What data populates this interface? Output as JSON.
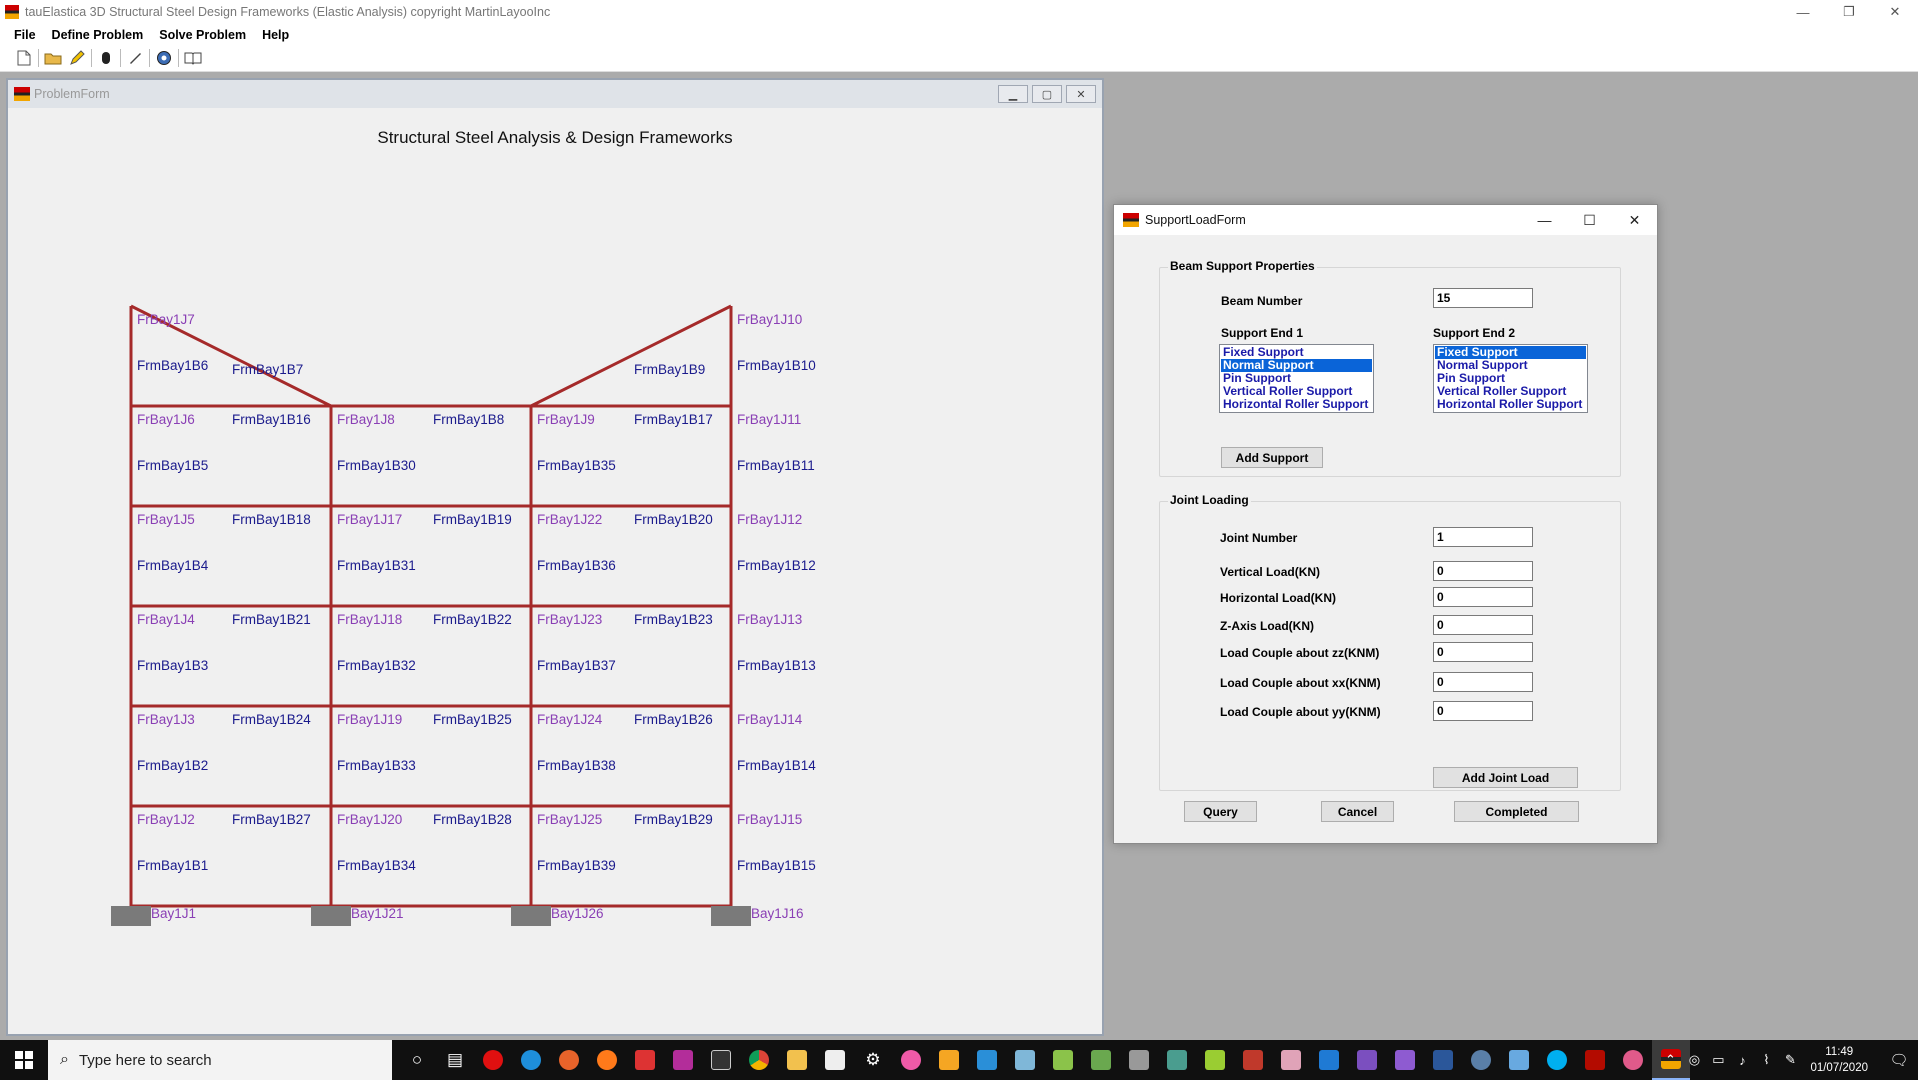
{
  "app": {
    "title": "tauElastica 3D Structural Steel Design Frameworks (Elastic Analysis) copyright MartinLayooInc",
    "menu": [
      "File",
      "Define Problem",
      "Solve Problem",
      "Help"
    ],
    "toolbar_icons": [
      "new-file-icon",
      "open-folder-icon",
      "pencil-icon",
      "mouse-icon",
      "brush-icon",
      "compass-icon",
      "book-icon"
    ]
  },
  "problem_form": {
    "title": "ProblemForm",
    "heading": "Structural Steel Analysis & Design Frameworks",
    "frame_color": "#a52a2a",
    "support_color": "#7a7a7a",
    "joint_label_color": "#8a3fb5",
    "beam_label_color": "#1a1a8c",
    "joint_labels": [
      "FrBay1J7",
      "FrBay1J10",
      "FrBay1J6",
      "FrBay1J8",
      "FrBay1J9",
      "FrBay1J11",
      "FrBay1J5",
      "FrBay1J17",
      "FrBay1J22",
      "FrBay1J12",
      "FrBay1J4",
      "FrBay1J18",
      "FrBay1J23",
      "FrBay1J13",
      "FrBay1J3",
      "FrBay1J19",
      "FrBay1J24",
      "FrBay1J14",
      "FrBay1J2",
      "FrBay1J20",
      "FrBay1J25",
      "FrBay1J15",
      "Bay1J1",
      "Bay1J21",
      "Bay1J26",
      "Bay1J16"
    ],
    "beam_labels": [
      "FrmBay1B6",
      "FrmBay1B7",
      "FrmBay1B9",
      "FrmBay1B10",
      "FrmBay1B16",
      "FrmBay1B8",
      "FrmBay1B17",
      "FrmBay1B5",
      "FrmBay1B30",
      "FrmBay1B35",
      "FrmBay1B11",
      "FrmBay1B18",
      "FrmBay1B19",
      "FrmBay1B20",
      "FrmBay1B4",
      "FrmBay1B31",
      "FrmBay1B36",
      "FrmBay1B12",
      "FrmBay1B21",
      "FrmBay1B22",
      "FrmBay1B23",
      "FrmBay1B3",
      "FrmBay1B32",
      "FrmBay1B37",
      "FrmBay1B13",
      "FrmBay1B24",
      "FrmBay1B25",
      "FrmBay1B26",
      "FrmBay1B2",
      "FrmBay1B33",
      "FrmBay1B38",
      "FrmBay1B14",
      "FrmBay1B27",
      "FrmBay1B28",
      "FrmBay1B29",
      "FrmBay1B1",
      "FrmBay1B34",
      "FrmBay1B39",
      "FrmBay1B15"
    ]
  },
  "dialog": {
    "title": "SupportLoadForm",
    "beam_group": {
      "title": "Beam  Support Properties",
      "beam_number_label": "Beam Number",
      "beam_number": "15",
      "end1_label": "Support End 1",
      "end2_label": "Support End 2",
      "options": [
        "Fixed Support",
        "Normal Support",
        "Pin Support",
        "Vertical Roller Support",
        "Horizontal Roller Support"
      ],
      "end1_selected": "Normal Support",
      "end2_selected": "Fixed Support",
      "add_support": "Add Support"
    },
    "joint_group": {
      "title": "Joint  Loading",
      "fields": [
        {
          "label": "Joint Number",
          "value": "1"
        },
        {
          "label": "Vertical Load(KN)",
          "value": "0"
        },
        {
          "label": "Horizontal Load(KN)",
          "value": "0"
        },
        {
          "label": "Z-Axis Load(KN)",
          "value": "0"
        },
        {
          "label": "Load Couple about zz(KNM)",
          "value": "0"
        },
        {
          "label": "Load Couple about xx(KNM)",
          "value": "0"
        },
        {
          "label": "Load Couple about yy(KNM)",
          "value": "0"
        }
      ],
      "add_joint_load": "Add Joint Load"
    },
    "buttons": {
      "query": "Query",
      "cancel": "Cancel",
      "completed": "Completed"
    }
  },
  "taskbar": {
    "search_placeholder": "Type here to search",
    "time": "11:49",
    "date": "01/07/2020"
  }
}
